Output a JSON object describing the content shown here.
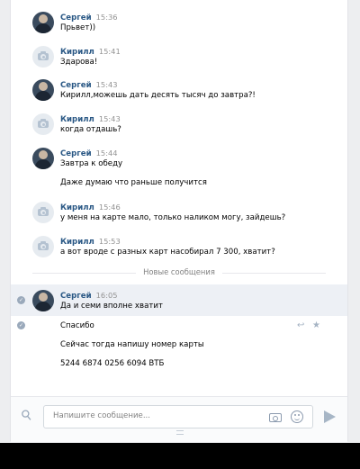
{
  "messages": [
    {
      "sender": "Сергей",
      "time": "15:36",
      "avatar": "user-photo",
      "lines": [
        "Прьвет))"
      ]
    },
    {
      "sender": "Кирилл",
      "time": "15:41",
      "avatar": "camera-placeholder",
      "lines": [
        "Здарова!"
      ]
    },
    {
      "sender": "Сергей",
      "time": "15:43",
      "avatar": "user-photo",
      "lines": [
        "Кирилл,можешь дать десять тысяч до завтра?!"
      ]
    },
    {
      "sender": "Кирилл",
      "time": "15:43",
      "avatar": "camera-placeholder",
      "lines": [
        "когда отдашь?"
      ]
    },
    {
      "sender": "Сергей",
      "time": "15:44",
      "avatar": "user-photo",
      "lines": [
        "Завтра к обеду",
        "Даже думаю что раньше получится"
      ]
    },
    {
      "sender": "Кирилл",
      "time": "15:46",
      "avatar": "camera-placeholder",
      "lines": [
        "у меня на карте мало, только наликом могу, зайдешь?"
      ]
    },
    {
      "sender": "Кирилл",
      "time": "15:53",
      "avatar": "camera-placeholder",
      "lines": [
        "а вот вроде с разных карт насобирал 7 300, хватит?"
      ]
    }
  ],
  "divider": {
    "label": "Новые сообщения"
  },
  "new_messages": {
    "sender": "Сергей",
    "time": "16:05",
    "lines": [
      "Да и семи вполне хватит",
      "Спасибо",
      "Сейчас тогда напишу номер карты",
      "5244 6874 0256 6094 ВТБ"
    ]
  },
  "composer": {
    "placeholder": "Напишите сообщение..."
  },
  "colors": {
    "name": "#2a5885",
    "time": "#939393",
    "highlight": "#edf0f5",
    "background": "#edeef0"
  },
  "icons": [
    "camera-placeholder-icon",
    "check-icon",
    "reply-icon",
    "star-icon",
    "paperclip-icon",
    "camera-icon",
    "smile-icon",
    "send-icon"
  ]
}
